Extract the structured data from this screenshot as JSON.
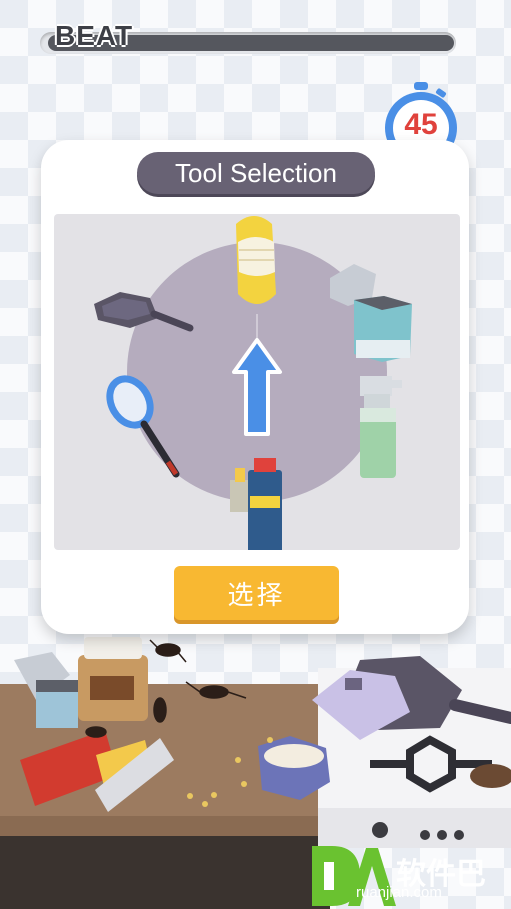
{
  "hud": {
    "score_label": "BEAT",
    "progress": 0.0,
    "timer_value": "45"
  },
  "dialog": {
    "title": "Tool Selection",
    "select_button_label": "选择",
    "tools": [
      {
        "name": "slipper-icon",
        "selected": true
      },
      {
        "name": "frying-pan-icon",
        "selected": false
      },
      {
        "name": "jar-icon",
        "selected": false
      },
      {
        "name": "electric-swatter-icon",
        "selected": false
      },
      {
        "name": "spray-bottle-icon",
        "selected": false
      },
      {
        "name": "spray-can-lighter-icon",
        "selected": false
      }
    ],
    "pointer_icon": "up-arrow-icon"
  },
  "watermark": {
    "brand": "软件巴",
    "domain": "ruanjian.com"
  },
  "colors": {
    "dialog_title_bg": "#686274",
    "button_bg": "#f8b832",
    "selection_circle": "#b5acbe",
    "arrow": "#4a8fe6",
    "timer_red": "#e0423c",
    "watermark_green": "#6ac230"
  }
}
